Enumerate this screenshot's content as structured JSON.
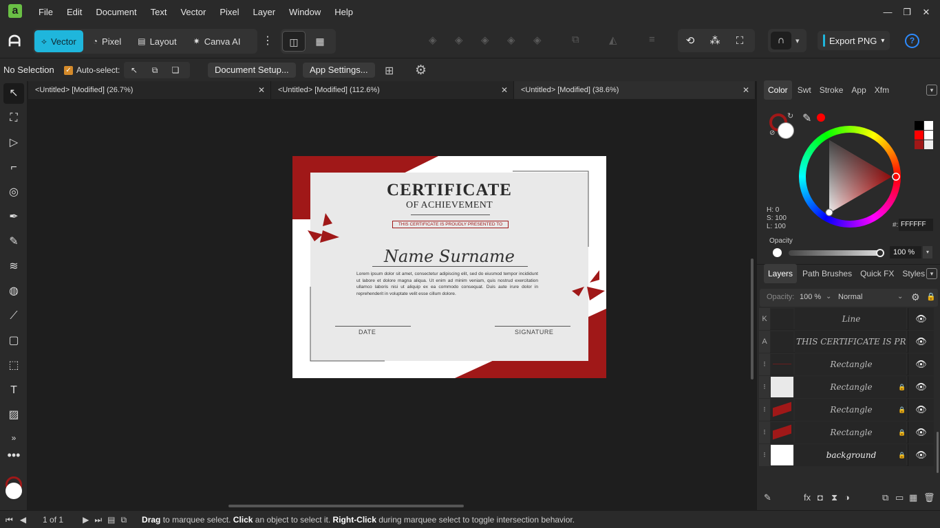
{
  "app": {
    "logo": "a",
    "menus": [
      "File",
      "Edit",
      "Document",
      "Text",
      "Vector",
      "Pixel",
      "Layer",
      "Window",
      "Help"
    ],
    "window_controls": [
      "minimize-icon",
      "restore-icon",
      "close-icon"
    ]
  },
  "toolbar": {
    "personas": [
      {
        "label": "Vector",
        "icon": "vector-persona-icon"
      },
      {
        "label": "Pixel",
        "icon": "pixel-persona-icon"
      },
      {
        "label": "Layout",
        "icon": "layout-persona-icon"
      },
      {
        "label": "Canva AI",
        "icon": "canva-ai-icon"
      }
    ],
    "export_label": "Export PNG",
    "help_label": "?",
    "accent": "#1fb6dc"
  },
  "context": {
    "selection": "No Selection",
    "auto_select": "Auto-select:",
    "document_setup": "Document Setup...",
    "app_settings": "App Settings..."
  },
  "tabs": [
    {
      "label": "<Untitled> [Modified] (26.7%)"
    },
    {
      "label": "<Untitled> [Modified] (112.6%)"
    },
    {
      "label": "<Untitled> [Modified] (38.6%)"
    }
  ],
  "certificate": {
    "title": "CERTIFICATE",
    "subtitle": "OF ACHIEVEMENT",
    "presented": "THIS CERTIFICATE IS PROUDLY PRESENTED TO",
    "name": "Name Surname",
    "body": "Lorem ipsum dolor sit amet, consectetur adipiscing elit, sed do eiusmod tempor incididunt ut labore et dolore magna aliqua. Ut enim ad minim veniam, quis nostrud exercitation ullamco laboris nisi ut aliquip ex ea commodo consequat. Duis aute irure dolor in reprehenderit in voluptate velit esse cillum dolore.",
    "date_label": "DATE",
    "signature_label": "SIGNATURE",
    "accent": "#a01818"
  },
  "color_panel": {
    "tabs": [
      "Color",
      "Swt",
      "Stroke",
      "App",
      "Xfm"
    ],
    "h": "H: 0",
    "s": "S: 100",
    "l": "L: 100",
    "hex_label": "#:",
    "hex": "FFFFFF",
    "opacity_label": "Opacity",
    "opacity": "100 %",
    "stroke_color": "#a01818",
    "fill_color": "#ffffff",
    "picked_color": "#ff0000"
  },
  "layers_panel": {
    "tabs": [
      "Layers",
      "Path Brushes",
      "Quick FX",
      "Styles"
    ],
    "opacity_label": "Opacity:",
    "opacity": "100 %",
    "blend": "Normal",
    "rows": [
      {
        "kind": "K",
        "name": "Line",
        "locked": false
      },
      {
        "kind": "A",
        "name": "THIS CERTIFICATE IS PR...",
        "locked": false
      },
      {
        "kind": "⁝",
        "name": "Rectangle",
        "locked": false
      },
      {
        "kind": "⁝",
        "name": "Rectangle",
        "locked": true
      },
      {
        "kind": "⁝",
        "name": "Rectangle",
        "locked": true
      },
      {
        "kind": "⁝",
        "name": "Rectangle",
        "locked": true
      },
      {
        "kind": "⁝",
        "name": "background",
        "locked": true
      }
    ]
  },
  "status": {
    "page": "1 of 1",
    "hint_drag": "Drag",
    "hint_1": " to marquee select. ",
    "hint_click": "Click",
    "hint_2": " an object to select it. ",
    "hint_right": "Right-Click",
    "hint_3": " during marquee select to toggle intersection behavior."
  }
}
